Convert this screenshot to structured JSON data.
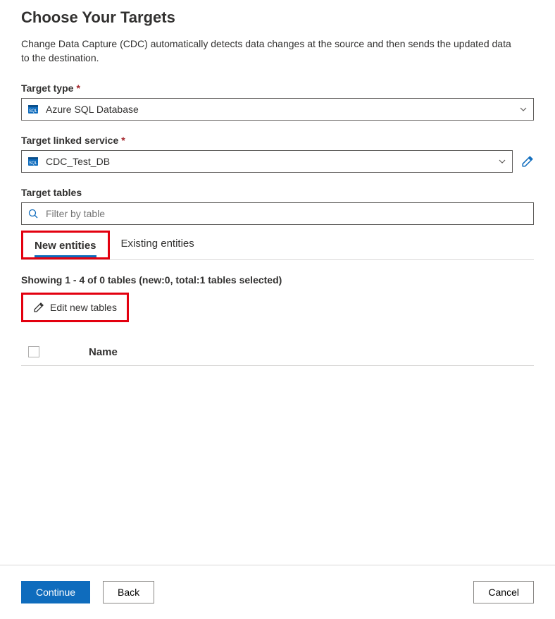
{
  "page": {
    "title": "Choose Your Targets",
    "description": "Change Data Capture (CDC) automatically detects data changes at the source and then sends the updated data to the destination."
  },
  "targetType": {
    "label": "Target type",
    "value": "Azure SQL Database"
  },
  "targetLinkedService": {
    "label": "Target linked service",
    "value": "CDC_Test_DB"
  },
  "targetTables": {
    "label": "Target tables",
    "filterPlaceholder": "Filter by table"
  },
  "tabs": {
    "new": "New entities",
    "existing": "Existing entities"
  },
  "status": "Showing 1 - 4 of 0 tables (new:0, total:1 tables selected)",
  "editNewTables": "Edit new tables",
  "tableHeader": {
    "name": "Name"
  },
  "footer": {
    "continue": "Continue",
    "back": "Back",
    "cancel": "Cancel"
  }
}
